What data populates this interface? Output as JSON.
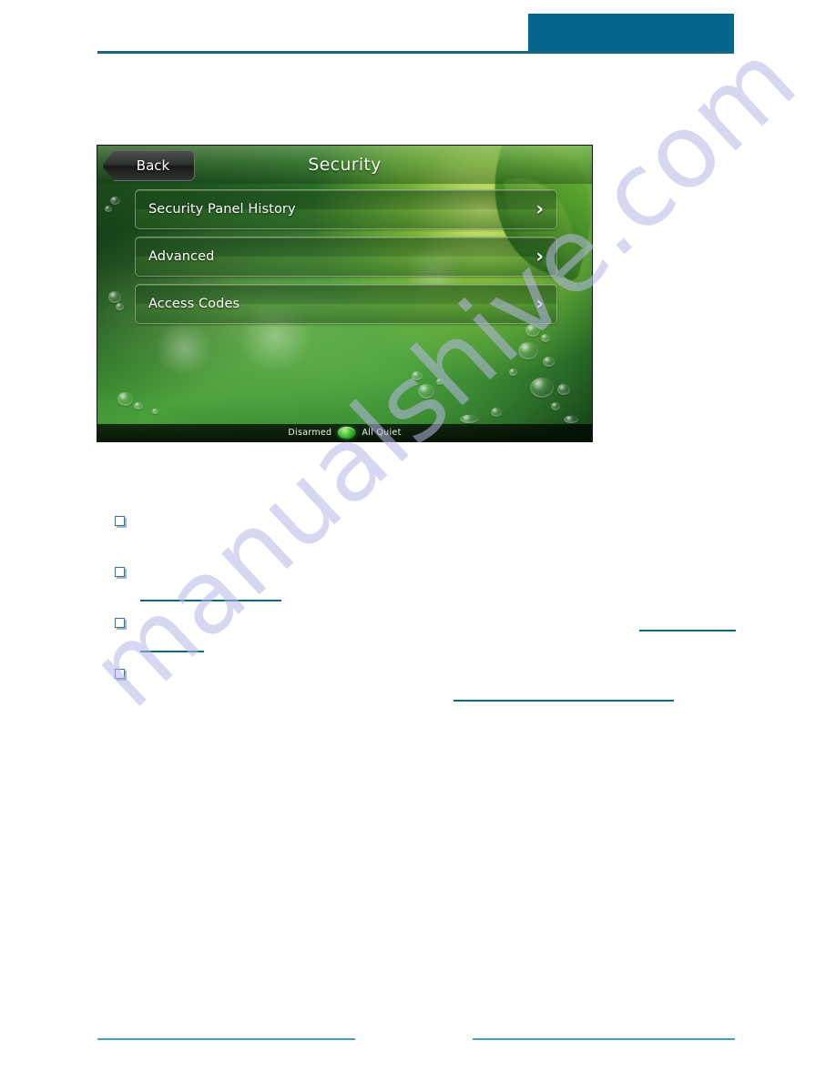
{
  "page": {
    "header_title": "",
    "accent_color": "#04658f",
    "rule_color": "#17697f",
    "link_color": "#0d6a80",
    "footer_rule_color": "#4a9cc4",
    "watermark": "manualshive.com"
  },
  "device": {
    "title": "Security",
    "back_label": "Back",
    "chevron": "›",
    "menu_items": [
      {
        "label": "Security Panel History"
      },
      {
        "label": "Advanced"
      },
      {
        "label": "Access Codes"
      }
    ],
    "status_bar": {
      "arm_state": "Disarmed",
      "sensor_state": "All Quiet",
      "led_color": "#49c63c"
    }
  },
  "body_list": {
    "items": [
      {
        "text": ""
      },
      {
        "text": ""
      },
      {
        "text": ""
      },
      {
        "text": ""
      }
    ]
  },
  "footer": {
    "left_text": "",
    "right_text": ""
  }
}
